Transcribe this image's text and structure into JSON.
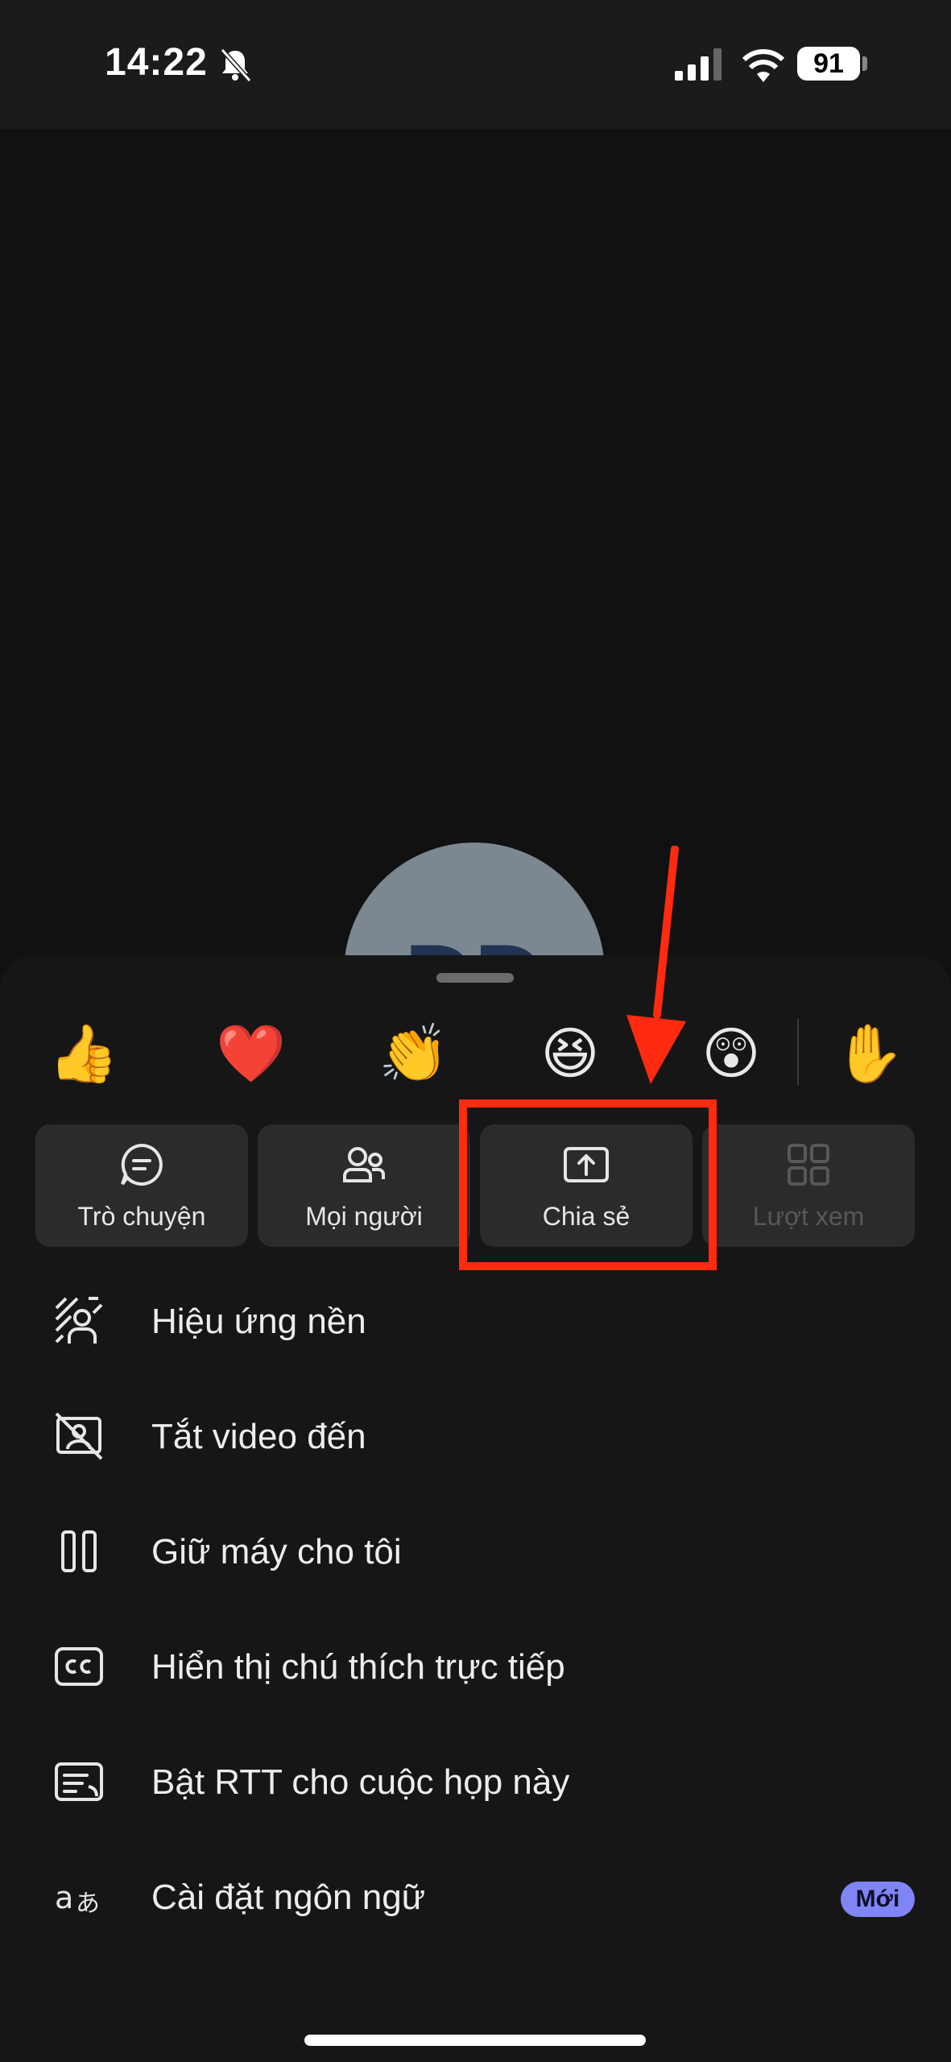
{
  "status_bar": {
    "time": "14:22",
    "battery": "91"
  },
  "participant": {
    "initials": "DD"
  },
  "reactions": [
    {
      "name": "thumbs-up",
      "glyph": "👍"
    },
    {
      "name": "heart",
      "glyph": "❤️"
    },
    {
      "name": "clapping",
      "glyph": "👏"
    },
    {
      "name": "laughing",
      "glyph": "😆"
    },
    {
      "name": "surprised",
      "glyph": "😲"
    },
    {
      "name": "raise-hand",
      "glyph": "✋"
    }
  ],
  "tiles": [
    {
      "label": "Trò chuyện",
      "icon": "chat-icon"
    },
    {
      "label": "Mọi người",
      "icon": "people-icon"
    },
    {
      "label": "Chia sẻ",
      "icon": "share-screen-icon"
    },
    {
      "label": "Lượt xem",
      "icon": "grid-view-icon"
    }
  ],
  "menu": [
    {
      "label": "Hiệu ứng nền",
      "icon": "background-effects-icon"
    },
    {
      "label": "Tắt video đến",
      "icon": "video-off-icon"
    },
    {
      "label": "Giữ máy cho tôi",
      "icon": "hold-icon"
    },
    {
      "label": "Hiển thị chú thích trực tiếp",
      "icon": "captions-icon"
    },
    {
      "label": "Bật RTT cho cuộc họp này",
      "icon": "rtt-icon"
    },
    {
      "label": "Cài đặt ngôn ngữ",
      "icon": "language-icon",
      "badge": "Mới"
    }
  ],
  "colors": {
    "annotation_red": "#ff2a0f",
    "badge_purple": "#7f85f5",
    "sheet_bg": "#161616",
    "tile_bg": "#2b2b2b"
  }
}
